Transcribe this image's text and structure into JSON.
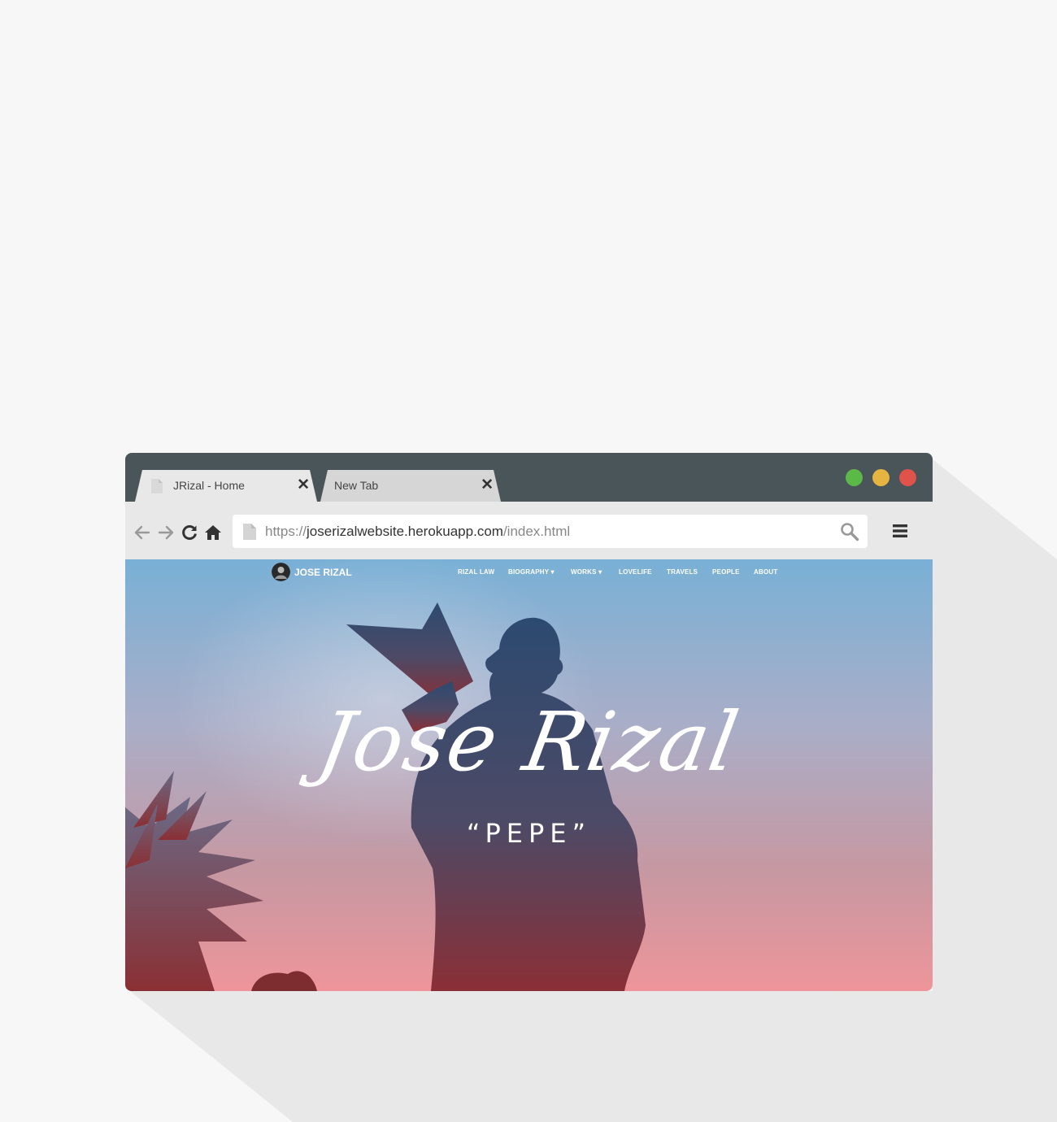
{
  "browser": {
    "tabs": [
      {
        "title": "JRizal - Home",
        "active": true
      },
      {
        "title": "New Tab",
        "active": false
      }
    ],
    "close_glyph": "✕",
    "window_controls": [
      "green",
      "yellow",
      "red"
    ],
    "url": {
      "prefix": "https://",
      "domain": "joserizalwebsite.herokuapp.com",
      "path": "/index.html"
    },
    "icons": [
      "page-icon",
      "back-arrow-icon",
      "forward-arrow-icon",
      "reload-icon",
      "home-icon",
      "search-icon",
      "menu-icon"
    ]
  },
  "site": {
    "brand": "JOSE RIZAL",
    "nav": [
      {
        "label": "RIZAL LAW"
      },
      {
        "label": "BIOGRAPHY ▾"
      },
      {
        "label": "WORKS ▾"
      },
      {
        "label": "LOVELIFE"
      },
      {
        "label": "TRAVELS"
      },
      {
        "label": "PEOPLE"
      },
      {
        "label": "ABOUT"
      }
    ],
    "hero": {
      "title": "Jose Rizal",
      "subtitle": "“PEPE”"
    }
  },
  "colors": {
    "titlebar": "#4a5559",
    "toolbar": "#e8e8e8",
    "dot_green": "#5bb947",
    "dot_yellow": "#e6b440",
    "dot_red": "#e0534a",
    "sky_top": "#79b0d6",
    "sky_bottom": "#ee959a"
  }
}
